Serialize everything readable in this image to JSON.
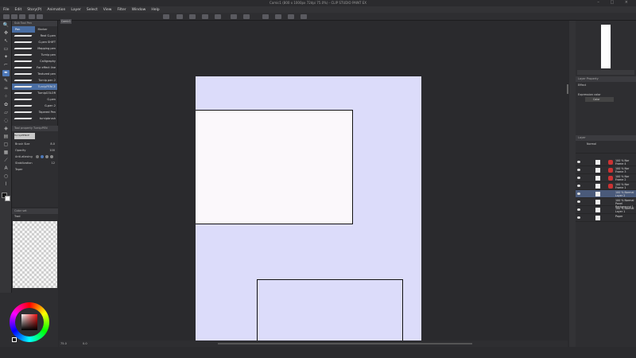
{
  "window": {
    "title": "Comic1 (800 x 1000px 72dpi 75.0%) - CLIP STUDIO PAINT EX",
    "controls": "– □ ×"
  },
  "menu": [
    "File",
    "Edit",
    "Story(P)",
    "Animation",
    "Layer",
    "Select",
    "View",
    "Filter",
    "Window",
    "Help"
  ],
  "document_tab": "Comic1",
  "subtool": {
    "header": "Sub Tool Pen",
    "tabs": [
      "Pen",
      "Marker"
    ],
    "brushes": [
      {
        "name": "Real G-pen"
      },
      {
        "name": "G-pen SHIFT"
      },
      {
        "name": "Mapping pen"
      },
      {
        "name": "Turnip pen"
      },
      {
        "name": "Calligraphy"
      },
      {
        "name": "For effect line"
      },
      {
        "name": "Textured pen"
      },
      {
        "name": "Turnip pen 2"
      },
      {
        "name": "TurnipPENCE",
        "selected": true
      },
      {
        "name": "TurnipCOLOR"
      },
      {
        "name": "G-pen"
      },
      {
        "name": "G-pen 2"
      },
      {
        "name": "Tapered Pen"
      },
      {
        "name": "turnipbrush"
      }
    ]
  },
  "tool_property": {
    "header": "Tool property TurnipPEN",
    "brush_name": "TurnipPENCE",
    "rows": [
      {
        "label": "Brush Size",
        "value": "8.0"
      },
      {
        "label": "Opacity",
        "value": "100"
      },
      {
        "label": "Anti-aliasing",
        "value": ""
      },
      {
        "label": "Stabilization",
        "value": "12"
      },
      {
        "label": "Taper",
        "value": ""
      }
    ]
  },
  "color_panel": {
    "header": "Color set",
    "tab": "Trad"
  },
  "layer_property": {
    "header": "Layer Property",
    "effect_label": "Effect",
    "expression_label": "Expression color",
    "expression_value": "Color"
  },
  "layers_panel": {
    "header": "Layer",
    "blend_mode": "Normal",
    "layers": [
      {
        "name": "100 % Nor Frame 4",
        "selected": false,
        "framed": true
      },
      {
        "name": "100 % Nor Frame 3",
        "selected": false,
        "framed": true
      },
      {
        "name": "100 % Nor Frame 2",
        "selected": false,
        "framed": true
      },
      {
        "name": "100 % Nor Frame 1",
        "selected": false,
        "framed": true
      },
      {
        "name": "100 % Normal Layer 2",
        "selected": true,
        "framed": false
      },
      {
        "name": "100 % Normal Panel Background 1",
        "selected": false,
        "framed": false
      },
      {
        "name": "100 % Normal Layer 1",
        "selected": false,
        "framed": false
      },
      {
        "name": "Paper",
        "selected": false,
        "framed": false
      }
    ]
  },
  "status": {
    "zoom": "75.0",
    "angle": "0.0"
  },
  "colors": {
    "accent": "#4d78b8",
    "paper": "#dcdcfa",
    "frame_fill": "#fbf8fb"
  }
}
